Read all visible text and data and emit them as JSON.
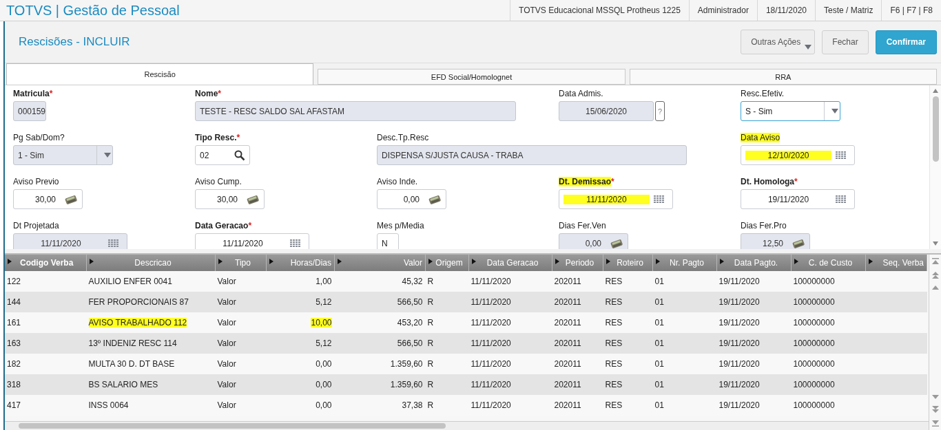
{
  "app_bar": {
    "title": "TOTVS | Gestão de Pessoal",
    "info": [
      "TOTVS Educacional MSSQL Protheus 1225",
      "Administrador",
      "18/11/2020",
      "Teste / Matriz",
      "F6 | F7 | F8"
    ]
  },
  "page": {
    "title": "Rescisões - INCLUIR",
    "buttons": [
      {
        "label": "Outras Ações",
        "kind": "menu"
      },
      {
        "label": "Fechar",
        "kind": "plain"
      },
      {
        "label": "Confirmar",
        "kind": "primary"
      }
    ]
  },
  "tabs": [
    {
      "label": "Rescisão",
      "selected": true
    },
    {
      "label": "EFD Social/Homolognet",
      "selected": false
    },
    {
      "label": "RRA",
      "selected": false
    }
  ],
  "form": {
    "fields": [
      {
        "label": "Matricula",
        "required": true,
        "mark": "*",
        "highlighted": false,
        "kind": "text",
        "value": "000159",
        "disabled": true,
        "value_highlighted": false
      },
      {
        "label": "Nome",
        "required": true,
        "mark": "*",
        "highlighted": false,
        "kind": "text",
        "value": "TESTE - RESC SALDO SAL AFASTAM",
        "disabled": true,
        "value_highlighted": false
      },
      {
        "label": "Data Admis.",
        "required": false,
        "highlighted": false,
        "kind": "help",
        "value": "15/06/2020",
        "help": "?",
        "disabled": true,
        "value_highlighted": false
      },
      {
        "label": "Resc.Efetiv.",
        "required": false,
        "highlighted": false,
        "kind": "select",
        "value": "S - Sim",
        "disabled": false,
        "focused": true,
        "value_highlighted": false
      },
      {
        "label": "Pg Sab/Dom?",
        "required": false,
        "highlighted": false,
        "kind": "select",
        "value": "1 - Sim",
        "disabled": true,
        "value_highlighted": false
      },
      {
        "label": "Tipo Resc.",
        "required": true,
        "mark": "*",
        "highlighted": false,
        "kind": "lookup",
        "value": "02",
        "disabled": false,
        "value_highlighted": false
      },
      {
        "label": "Desc.Tp.Resc",
        "required": false,
        "highlighted": false,
        "kind": "text",
        "value": "DISPENSA S/JUSTA CAUSA - TRABA",
        "disabled": true,
        "value_highlighted": false
      },
      {
        "label": "Data Aviso",
        "required": false,
        "highlighted": true,
        "kind": "date",
        "value": "12/10/2020",
        "disabled": false,
        "value_highlighted": true
      },
      {
        "label": "Aviso Previo",
        "required": false,
        "highlighted": false,
        "kind": "number",
        "value": "30,00",
        "disabled": false,
        "value_highlighted": false
      },
      {
        "label": "Aviso Cump.",
        "required": false,
        "highlighted": false,
        "kind": "number",
        "value": "30,00",
        "disabled": false,
        "value_highlighted": false
      },
      {
        "label": "Aviso Inde.",
        "required": false,
        "highlighted": false,
        "kind": "number",
        "value": "0,00",
        "disabled": false,
        "value_highlighted": false
      },
      {
        "label": "Dt. Demissao",
        "required": true,
        "mark": "*",
        "highlighted": true,
        "kind": "date",
        "value": "11/11/2020",
        "disabled": false,
        "value_highlighted": true
      },
      {
        "label": "Dt. Homologa",
        "required": true,
        "mark": "*",
        "highlighted": false,
        "kind": "date",
        "value": "19/11/2020",
        "disabled": false,
        "value_highlighted": false
      },
      {
        "label": "Dt Projetada",
        "required": false,
        "highlighted": false,
        "kind": "date",
        "value": "11/11/2020",
        "disabled": true,
        "value_highlighted": false
      },
      {
        "label": "Data Geracao",
        "required": true,
        "mark": "*",
        "highlighted": false,
        "kind": "date",
        "value": "11/11/2020",
        "disabled": false,
        "value_highlighted": false
      },
      {
        "label": "Mes p/Media",
        "required": false,
        "highlighted": false,
        "kind": "text",
        "value": "N",
        "disabled": false,
        "value_highlighted": false
      },
      {
        "label": "Dias Fer.Ven",
        "required": false,
        "highlighted": false,
        "kind": "number",
        "value": "0,00",
        "disabled": true,
        "value_highlighted": false
      },
      {
        "label": "Dias Fer.Pro",
        "required": false,
        "highlighted": false,
        "kind": "number",
        "value": "12,50",
        "disabled": true,
        "value_highlighted": false
      }
    ]
  },
  "table": {
    "columns": [
      "Codigo Verba",
      "Descricao",
      "Tipo",
      "Horas/Dias",
      "Valor",
      "Origem",
      "Data Geracao",
      "Periodo",
      "Roteiro",
      "Nr. Pagto",
      "Data Pagto.",
      "C. de Custo",
      "Seq. Verba"
    ],
    "rows": [
      {
        "cells": [
          {
            "text": "122",
            "highlighted": false
          },
          {
            "text": "AUXILIO ENFER 0041",
            "highlighted": false
          },
          {
            "text": "Valor",
            "highlighted": false
          },
          {
            "text": "1,00",
            "highlighted": false
          },
          {
            "text": "45,32",
            "highlighted": false
          },
          {
            "text": "R",
            "highlighted": false
          },
          {
            "text": "11/11/2020",
            "highlighted": false
          },
          {
            "text": "202011",
            "highlighted": false
          },
          {
            "text": "RES",
            "highlighted": false
          },
          {
            "text": "01",
            "highlighted": false
          },
          {
            "text": "19/11/2020",
            "highlighted": false
          },
          {
            "text": "100000000",
            "highlighted": false
          }
        ]
      },
      {
        "cells": [
          {
            "text": "144",
            "highlighted": false
          },
          {
            "text": "FER PROPORCIONAIS 87",
            "highlighted": false
          },
          {
            "text": "Valor",
            "highlighted": false
          },
          {
            "text": "5,12",
            "highlighted": false
          },
          {
            "text": "566,50",
            "highlighted": false
          },
          {
            "text": "R",
            "highlighted": false
          },
          {
            "text": "11/11/2020",
            "highlighted": false
          },
          {
            "text": "202011",
            "highlighted": false
          },
          {
            "text": "RES",
            "highlighted": false
          },
          {
            "text": "01",
            "highlighted": false
          },
          {
            "text": "19/11/2020",
            "highlighted": false
          },
          {
            "text": "100000000",
            "highlighted": false
          }
        ]
      },
      {
        "cells": [
          {
            "text": "161",
            "highlighted": false
          },
          {
            "text": "AVISO TRABALHADO 112",
            "highlighted": true
          },
          {
            "text": "Valor",
            "highlighted": false
          },
          {
            "text": "10,00",
            "highlighted": true
          },
          {
            "text": "453,20",
            "highlighted": false
          },
          {
            "text": "R",
            "highlighted": false
          },
          {
            "text": "11/11/2020",
            "highlighted": false
          },
          {
            "text": "202011",
            "highlighted": false
          },
          {
            "text": "RES",
            "highlighted": false
          },
          {
            "text": "01",
            "highlighted": false
          },
          {
            "text": "19/11/2020",
            "highlighted": false
          },
          {
            "text": "100000000",
            "highlighted": false
          }
        ]
      },
      {
        "cells": [
          {
            "text": "163",
            "highlighted": false
          },
          {
            "text": "13º INDENIZ RESC 114",
            "highlighted": false
          },
          {
            "text": "Valor",
            "highlighted": false
          },
          {
            "text": "5,12",
            "highlighted": false
          },
          {
            "text": "566,50",
            "highlighted": false
          },
          {
            "text": "R",
            "highlighted": false
          },
          {
            "text": "11/11/2020",
            "highlighted": false
          },
          {
            "text": "202011",
            "highlighted": false
          },
          {
            "text": "RES",
            "highlighted": false
          },
          {
            "text": "01",
            "highlighted": false
          },
          {
            "text": "19/11/2020",
            "highlighted": false
          },
          {
            "text": "100000000",
            "highlighted": false
          }
        ]
      },
      {
        "cells": [
          {
            "text": "182",
            "highlighted": false
          },
          {
            "text": "MULTA 30 D. DT BASE",
            "highlighted": false
          },
          {
            "text": "Valor",
            "highlighted": false
          },
          {
            "text": "0,00",
            "highlighted": false
          },
          {
            "text": "1.359,60",
            "highlighted": false
          },
          {
            "text": "R",
            "highlighted": false
          },
          {
            "text": "11/11/2020",
            "highlighted": false
          },
          {
            "text": "202011",
            "highlighted": false
          },
          {
            "text": "RES",
            "highlighted": false
          },
          {
            "text": "01",
            "highlighted": false
          },
          {
            "text": "19/11/2020",
            "highlighted": false
          },
          {
            "text": "100000000",
            "highlighted": false
          }
        ]
      },
      {
        "cells": [
          {
            "text": "318",
            "highlighted": false
          },
          {
            "text": "BS SALARIO MES",
            "highlighted": false
          },
          {
            "text": "Valor",
            "highlighted": false
          },
          {
            "text": "0,00",
            "highlighted": false
          },
          {
            "text": "1.359,60",
            "highlighted": false
          },
          {
            "text": "R",
            "highlighted": false
          },
          {
            "text": "11/11/2020",
            "highlighted": false
          },
          {
            "text": "202011",
            "highlighted": false
          },
          {
            "text": "RES",
            "highlighted": false
          },
          {
            "text": "01",
            "highlighted": false
          },
          {
            "text": "19/11/2020",
            "highlighted": false
          },
          {
            "text": "100000000",
            "highlighted": false
          }
        ]
      },
      {
        "cells": [
          {
            "text": "417",
            "highlighted": false
          },
          {
            "text": "INSS 0064",
            "highlighted": false
          },
          {
            "text": "Valor",
            "highlighted": false
          },
          {
            "text": "0,00",
            "highlighted": false
          },
          {
            "text": "37,38",
            "highlighted": false
          },
          {
            "text": "R",
            "highlighted": false
          },
          {
            "text": "11/11/2020",
            "highlighted": false
          },
          {
            "text": "202011",
            "highlighted": false
          },
          {
            "text": "RES",
            "highlighted": false
          },
          {
            "text": "01",
            "highlighted": false
          },
          {
            "text": "19/11/2020",
            "highlighted": false
          },
          {
            "text": "100000000",
            "highlighted": false
          }
        ]
      }
    ]
  }
}
